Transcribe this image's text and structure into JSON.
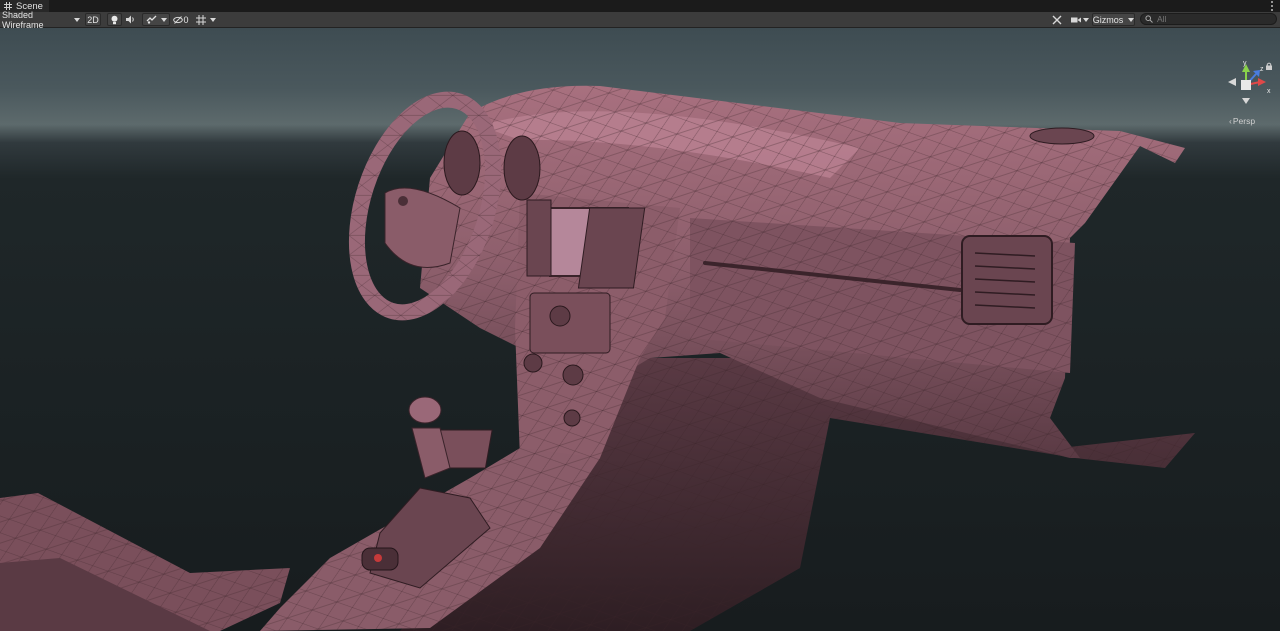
{
  "window": {
    "tab_title": "Scene",
    "tab_icon": "scene-grid-icon"
  },
  "toolbar": {
    "draw_mode": "Shaded Wireframe",
    "mode_2d": "2D",
    "hidden_count": "0",
    "gizmos_label": "Gizmos",
    "search_placeholder": "All"
  },
  "viewport": {
    "projection_label": "Persp",
    "gizmo_axes": {
      "y": "y",
      "x": "x",
      "z": "z"
    },
    "colors": {
      "mesh": "#8a5e6a",
      "wire": "#3a2228",
      "y_axis": "#8ad14b",
      "x_axis": "#e04848",
      "z_axis": "#4a7ce0"
    }
  }
}
